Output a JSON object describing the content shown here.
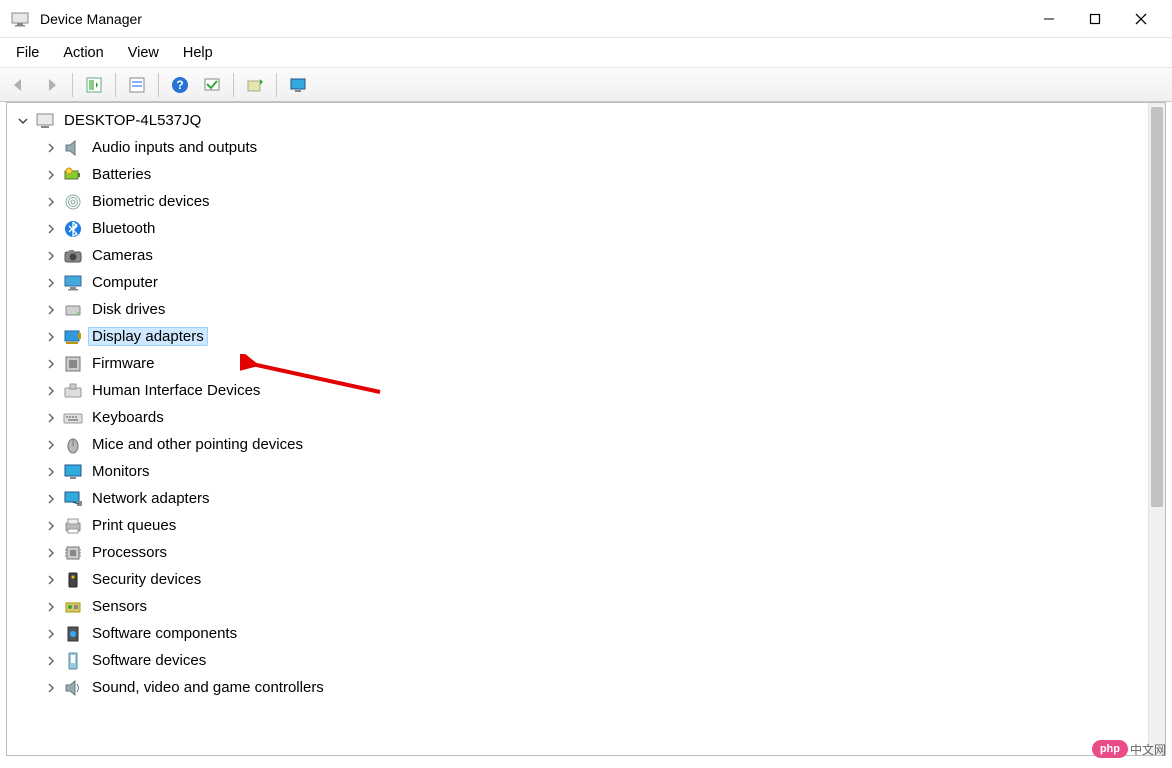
{
  "window": {
    "title": "Device Manager"
  },
  "menu": {
    "file": "File",
    "action": "Action",
    "view": "View",
    "help": "Help"
  },
  "toolbar": {
    "back": "back",
    "forward": "forward",
    "show_hidden": "show-hidden",
    "properties": "properties",
    "help": "help",
    "scan": "scan",
    "update": "update",
    "uninstall": "uninstall"
  },
  "tree": {
    "root": "DESKTOP-4L537JQ",
    "items": [
      {
        "label": "Audio inputs and outputs",
        "icon": "speaker-icon",
        "selected": false
      },
      {
        "label": "Batteries",
        "icon": "battery-icon",
        "selected": false
      },
      {
        "label": "Biometric devices",
        "icon": "fingerprint-icon",
        "selected": false
      },
      {
        "label": "Bluetooth",
        "icon": "bluetooth-icon",
        "selected": false
      },
      {
        "label": "Cameras",
        "icon": "camera-icon",
        "selected": false
      },
      {
        "label": "Computer",
        "icon": "computer-icon",
        "selected": false
      },
      {
        "label": "Disk drives",
        "icon": "disk-icon",
        "selected": false
      },
      {
        "label": "Display adapters",
        "icon": "display-adapter-icon",
        "selected": true
      },
      {
        "label": "Firmware",
        "icon": "firmware-icon",
        "selected": false
      },
      {
        "label": "Human Interface Devices",
        "icon": "hid-icon",
        "selected": false
      },
      {
        "label": "Keyboards",
        "icon": "keyboard-icon",
        "selected": false
      },
      {
        "label": "Mice and other pointing devices",
        "icon": "mouse-icon",
        "selected": false
      },
      {
        "label": "Monitors",
        "icon": "monitor-icon",
        "selected": false
      },
      {
        "label": "Network adapters",
        "icon": "network-icon",
        "selected": false
      },
      {
        "label": "Print queues",
        "icon": "printer-icon",
        "selected": false
      },
      {
        "label": "Processors",
        "icon": "processor-icon",
        "selected": false
      },
      {
        "label": "Security devices",
        "icon": "security-icon",
        "selected": false
      },
      {
        "label": "Sensors",
        "icon": "sensor-icon",
        "selected": false
      },
      {
        "label": "Software components",
        "icon": "software-component-icon",
        "selected": false
      },
      {
        "label": "Software devices",
        "icon": "software-device-icon",
        "selected": false
      },
      {
        "label": "Sound, video and game controllers",
        "icon": "sound-icon",
        "selected": false
      }
    ]
  },
  "watermark": {
    "badge": "php",
    "text": "中文网"
  }
}
